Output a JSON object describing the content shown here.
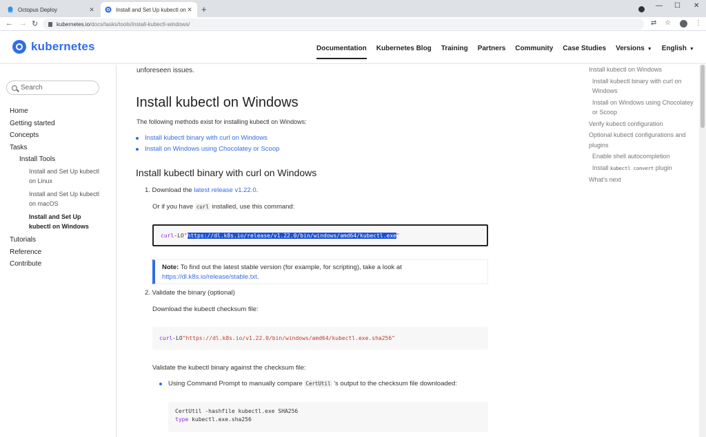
{
  "browser": {
    "tabs": [
      {
        "title": "Octopus Deploy",
        "active": false
      },
      {
        "title": "Install and Set Up kubectl on Wi",
        "active": true
      }
    ],
    "new_tab": "+",
    "window_controls": {
      "minimize": "—",
      "maximize": "☐",
      "close": "✕"
    },
    "url_host": "kubernetes.io",
    "url_path": "/docs/tasks/tools/install-kubectl-windows/"
  },
  "site": {
    "logo_text": "kubernetes",
    "nav": [
      {
        "label": "Documentation"
      },
      {
        "label": "Kubernetes Blog"
      },
      {
        "label": "Training"
      },
      {
        "label": "Partners"
      },
      {
        "label": "Community"
      },
      {
        "label": "Case Studies"
      },
      {
        "label": "Versions"
      },
      {
        "label": "English"
      }
    ]
  },
  "sidebar": {
    "search_placeholder": "Search",
    "items": {
      "home": "Home",
      "getting_started": "Getting started",
      "concepts": "Concepts",
      "tasks": "Tasks",
      "install_tools": "Install Tools",
      "linux_1": "Install and Set Up kubectl",
      "linux_2": "on Linux",
      "macos_1": "Install and Set Up kubectl",
      "macos_2": "on macOS",
      "windows_1": "Install and Set Up",
      "windows_2": "kubectl on Windows",
      "tutorials": "Tutorials",
      "reference": "Reference",
      "contribute": "Contribute"
    }
  },
  "main": {
    "lead_tail": "unforeseen issues.",
    "title": "Install kubectl on Windows",
    "intro": "The following methods exist for installing kubectl on Windows:",
    "methods": [
      "Install kubectl binary with curl on Windows",
      "Install on Windows using Chocolatey or Scoop"
    ],
    "section_title": "Install kubectl binary with curl on Windows",
    "step1_prefix": "1. Download the ",
    "step1_link": "latest release v1.22.0",
    "step1_suffix": ".",
    "curl_note_pre": "Or if you have ",
    "curl_note_code": "curl",
    "curl_note_post": " installed, use this command:",
    "cmd1_keyword": "curl",
    "cmd1_flag": " -LO ",
    "cmd1_q": "\"",
    "cmd1_url": "https://dl.k8s.io/release/v1.22.0/bin/windows/amd64/kubectl.exe",
    "note_label": "Note:",
    "note_text": " To find out the latest stable version (for example, for scripting), take a look at",
    "note_link": "https://dl.k8s.io/release/stable.txt",
    "note_end": ".",
    "step2": "2. Validate the binary (optional)",
    "checksum_intro": "Download the kubectl checksum file:",
    "cmd2_keyword": "curl",
    "cmd2_flag": " -LO ",
    "cmd2_url": "\"https://dl.k8s.io/v1.22.0/bin/windows/amd64/kubectl.exe.sha256\"",
    "validate_text": "Validate the kubectl binary against the checksum file:",
    "cmd_prompt_pre": "Using Command Prompt to manually compare ",
    "cmd_prompt_code": "CertUtil",
    "cmd_prompt_post": " 's output to the checksum file downloaded:",
    "cmd3_line1": "CertUtil -hashfile kubectl.exe SHA256",
    "cmd3_kw": "type",
    "cmd3_line2": " kubectl.exe.sha256"
  },
  "toc": {
    "items": [
      "Install kubectl on Windows",
      "Install kubectl binary with curl on Windows",
      "Install on Windows using Chocolatey or Scoop",
      "Verify kubectl configuration",
      "Optional kubectl configurations and plugins",
      "Enable shell autocompletion"
    ],
    "convert_pre": "Install ",
    "convert_code": "kubectl convert",
    "convert_post": " plugin",
    "whats_next": "What's next"
  }
}
